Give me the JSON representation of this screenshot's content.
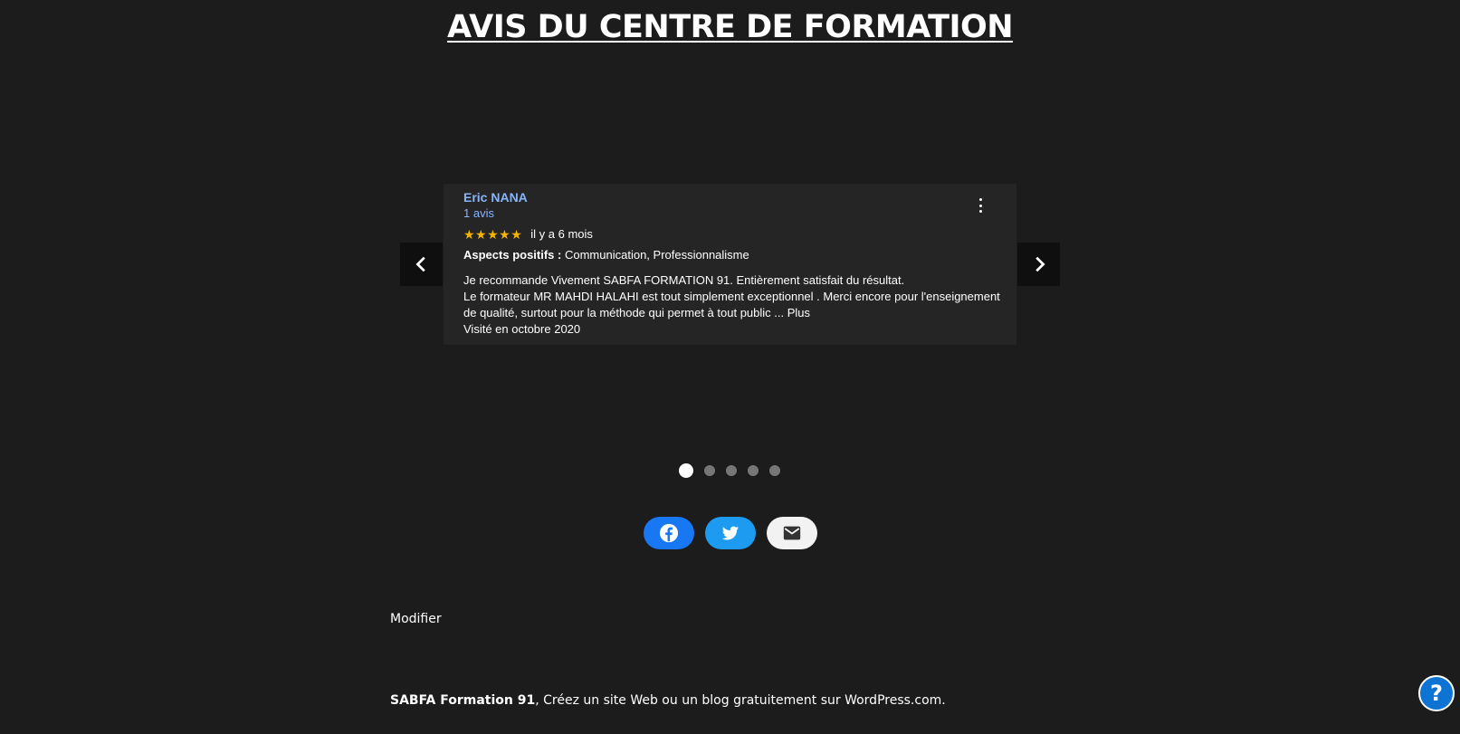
{
  "page": {
    "title": "AVIS DU CENTRE DE FORMATION"
  },
  "review": {
    "name": "Eric NANA",
    "count": "1 avis",
    "stars": "★★★★★",
    "rating": 5,
    "date": "il y a 6 mois",
    "aspects_label": "Aspects positifs :",
    "aspects_value": "Communication, Professionnalisme",
    "text_line1": "Je recommande Vivement SABFA FORMATION 91. Entièrement satisfait du résultat.",
    "text_line2": "Le formateur MR MAHDI HALAHI  est tout simplement exceptionnel . Merci encore pour l'enseignement",
    "text_line3": "de qualité, surtout pour la méthode qui permet à tout public ...",
    "more_label": "Plus",
    "visit": "Visité en octobre 2020"
  },
  "carousel": {
    "slide_count": 5,
    "active_index": 1
  },
  "actions": {
    "edit_label": "Modifier"
  },
  "footer": {
    "site_name": "SABFA Formation 91",
    "separator": ", ",
    "tagline": "Créez un site Web ou un blog gratuitement sur WordPress.com."
  },
  "help": {
    "label": "?"
  },
  "colors": {
    "background": "#1c1c1c",
    "card": "#252525",
    "link_blue": "#8ab4f8",
    "star": "#f4b400",
    "facebook": "#1877f2",
    "twitter": "#1d9bf0",
    "email": "#f2f2f2",
    "help": "#0d74d4"
  }
}
